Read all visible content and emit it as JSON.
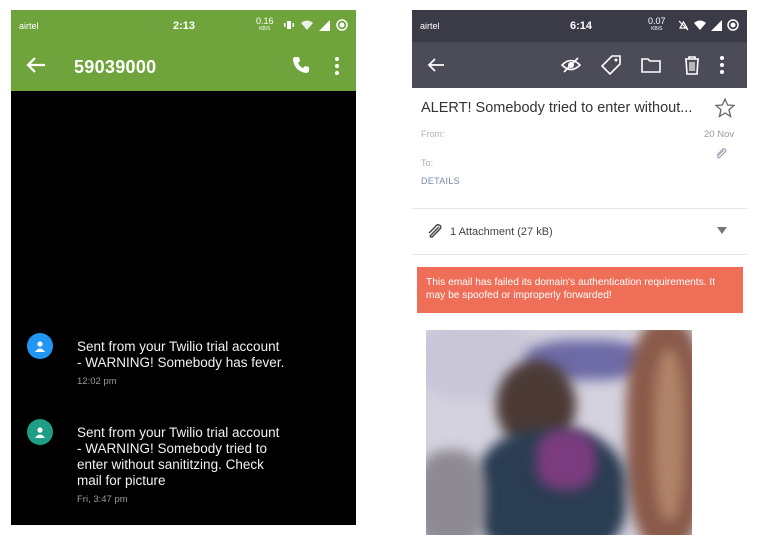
{
  "sms": {
    "status": {
      "carrier": "airtel",
      "time": "2:13",
      "speed_value": "0.16",
      "speed_unit": "KB/S"
    },
    "header": {
      "number": "59039000"
    },
    "messages": [
      {
        "text": "Sent from your Twilio trial account\n- WARNING! Somebody has fever.",
        "time": "12:02 pm",
        "avatar_color": "#2196f3"
      },
      {
        "text": "Sent from your Twilio trial account\n- WARNING! Somebody tried to\nenter without sanititzing. Check\nmail for picture",
        "time": "Fri, 3:47 pm",
        "avatar_color": "#1e9e84"
      }
    ],
    "colors": {
      "appbar": "#6fa43c",
      "background": "#000000"
    }
  },
  "email": {
    "status": {
      "carrier": "airtel",
      "time": "6:14",
      "speed_value": "0.07",
      "speed_unit": "KB/S"
    },
    "toolbar_icons": [
      "back-arrow-icon",
      "eye-off-icon",
      "tag-icon",
      "folder-icon",
      "trash-icon",
      "more-vert-icon"
    ],
    "subject": "ALERT! Somebody tried to enter without...",
    "from_label": "From:",
    "to_label": "To:",
    "date": "20 Nov",
    "details_link": "DETAILS",
    "attachment": {
      "label": "1 Attachment (27 kB)"
    },
    "warning": "This email has failed its domain's authentication requirements. It may be spoofed or improperly forwarded!",
    "colors": {
      "toolbar": "#4c4c59",
      "warning": "#ef6e58"
    }
  }
}
